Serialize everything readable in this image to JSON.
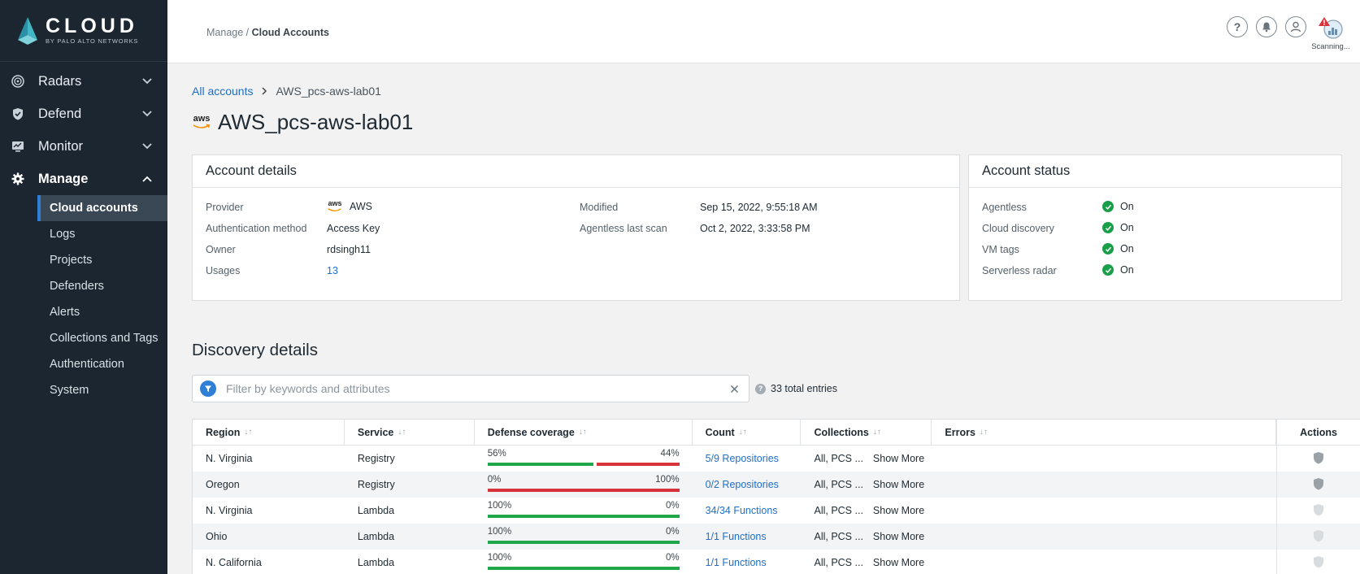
{
  "logo": {
    "word": "CLOUD",
    "sub": "BY PALO ALTO NETWORKS"
  },
  "nav": {
    "items": [
      {
        "label": "Radars",
        "icon": "radar-icon"
      },
      {
        "label": "Defend",
        "icon": "shield-icon"
      },
      {
        "label": "Monitor",
        "icon": "monitor-icon"
      },
      {
        "label": "Manage",
        "icon": "gear-icon"
      }
    ],
    "sub_items": [
      "Cloud accounts",
      "Logs",
      "Projects",
      "Defenders",
      "Alerts",
      "Collections and Tags",
      "Authentication",
      "System"
    ]
  },
  "header": {
    "breadcrumb_parent": "Manage",
    "breadcrumb_sep": "/",
    "breadcrumb_current": "Cloud Accounts",
    "help_glyph": "?",
    "scan_status": "Scanning..."
  },
  "page": {
    "crumb_link": "All accounts",
    "crumb_current": "AWS_pcs-aws-lab01",
    "title": "AWS_pcs-aws-lab01",
    "aws_logo_text": "aws"
  },
  "account_details": {
    "title": "Account details",
    "provider_label": "Provider",
    "provider_value": "AWS",
    "auth_label": "Authentication method",
    "auth_value": "Access Key",
    "owner_label": "Owner",
    "owner_value": "rdsingh11",
    "usages_label": "Usages",
    "usages_value": "13",
    "modified_label": "Modified",
    "modified_value": "Sep 15, 2022, 9:55:18 AM",
    "scan_label": "Agentless last scan",
    "scan_value": "Oct 2, 2022, 3:33:58 PM"
  },
  "account_status": {
    "title": "Account status",
    "items": [
      {
        "label": "Agentless",
        "value": "On"
      },
      {
        "label": "Cloud discovery",
        "value": "On"
      },
      {
        "label": "VM tags",
        "value": "On"
      },
      {
        "label": "Serverless radar",
        "value": "On"
      }
    ]
  },
  "discovery": {
    "title": "Discovery details",
    "filter_placeholder": "Filter by keywords and attributes",
    "total_entries": "33 total entries",
    "columns": {
      "region": "Region",
      "service": "Service",
      "defense": "Defense coverage",
      "count": "Count",
      "collections": "Collections",
      "errors": "Errors",
      "actions": "Actions"
    },
    "sort_glyph": "↓↑",
    "show_more": "Show More",
    "rows": [
      {
        "region": "N. Virginia",
        "service": "Registry",
        "defended": 56,
        "undefended": 44,
        "left_label": "56%",
        "right_label": "44%",
        "count": "5/9 Repositories",
        "collections": "All, PCS ...",
        "errors": "",
        "action_enabled": true
      },
      {
        "region": "Oregon",
        "service": "Registry",
        "defended": 0,
        "undefended": 100,
        "left_label": "0%",
        "right_label": "100%",
        "count": "0/2 Repositories",
        "collections": "All, PCS ...",
        "errors": "",
        "action_enabled": true
      },
      {
        "region": "N. Virginia",
        "service": "Lambda",
        "defended": 100,
        "undefended": 0,
        "left_label": "100%",
        "right_label": "0%",
        "count": "34/34 Functions",
        "collections": "All, PCS ...",
        "errors": "",
        "action_enabled": false
      },
      {
        "region": "Ohio",
        "service": "Lambda",
        "defended": 100,
        "undefended": 0,
        "left_label": "100%",
        "right_label": "0%",
        "count": "1/1 Functions",
        "collections": "All, PCS ...",
        "errors": "",
        "action_enabled": false
      },
      {
        "region": "N. California",
        "service": "Lambda",
        "defended": 100,
        "undefended": 0,
        "left_label": "100%",
        "right_label": "0%",
        "count": "1/1 Functions",
        "collections": "All, PCS ...",
        "errors": "",
        "action_enabled": false
      }
    ]
  },
  "colors": {
    "accent": "#2f7fd6",
    "link": "#1f6fc6",
    "success": "#1fa84a",
    "danger": "#d6333b",
    "sidebar": "#1c2630"
  }
}
